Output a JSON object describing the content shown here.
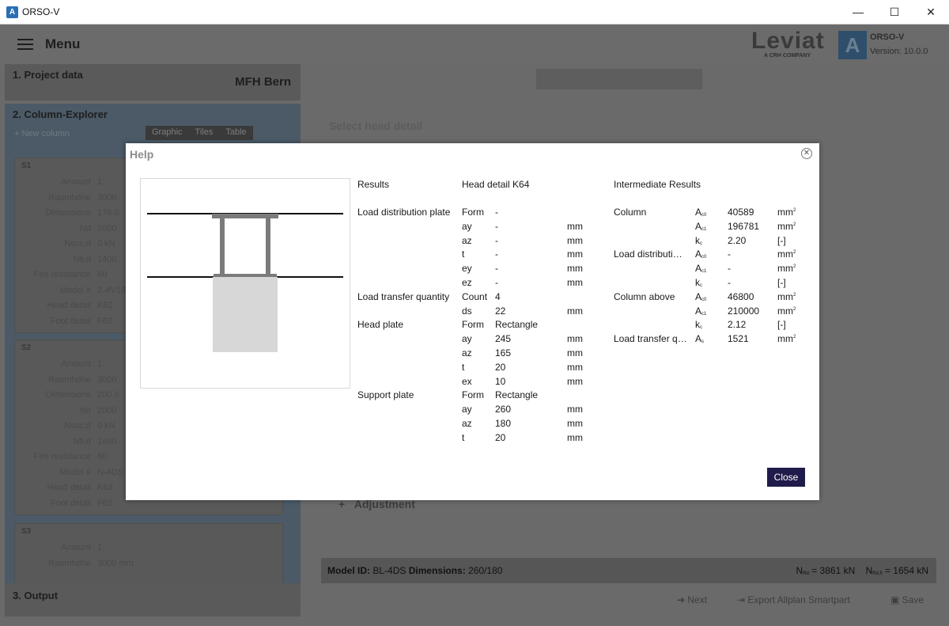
{
  "window": {
    "title": "ORSO-V",
    "app_icon": "A",
    "minimize": "—",
    "maximize": "☐",
    "close": "✕"
  },
  "header": {
    "menu_label": "Menu",
    "brand": "Leviat",
    "brand_sub": "A CRH COMPANY",
    "product": "ORSO-V",
    "version": "Version: 10.0.0",
    "logo_letter": "A"
  },
  "sidebar": {
    "project": {
      "title": "1. Project data",
      "name": "MFH Bern"
    },
    "explorer": {
      "title": "2. Column-Explorer",
      "new_column": "+ New column",
      "tabs": [
        "Graphic",
        "Tiles",
        "Table"
      ],
      "cards": [
        {
          "tag": "S1",
          "rows": [
            [
              "Amount",
              "1"
            ],
            [
              "Raumhöhe",
              "3000"
            ],
            [
              "Dimensions",
              "176.0"
            ],
            [
              "Nd",
              "2000"
            ],
            [
              "Nscc,d",
              "0 kN"
            ],
            [
              "Nfi,d",
              "1400"
            ],
            [
              "Fire resistance",
              "60"
            ],
            [
              "Model #",
              "Z-4V18"
            ],
            [
              "Head detail",
              "K62"
            ],
            [
              "Foot detail",
              "F62"
            ]
          ]
        },
        {
          "tag": "S2",
          "rows": [
            [
              "Amount",
              "1"
            ],
            [
              "Raumhöhe",
              "3000"
            ],
            [
              "Dimensions",
              "200.0"
            ],
            [
              "Nd",
              "2000"
            ],
            [
              "Nscc,d",
              "0 kN"
            ],
            [
              "Nfi,d",
              "1400"
            ],
            [
              "Fire resistance",
              "60"
            ],
            [
              "Model #",
              "N-4DS"
            ],
            [
              "Head detail",
              "K63"
            ],
            [
              "Foot detail",
              "F62"
            ]
          ]
        },
        {
          "tag": "S3",
          "rows": [
            [
              "Amount",
              "1"
            ],
            [
              "Raumhöhe",
              "3000 mm"
            ]
          ]
        }
      ]
    },
    "output": {
      "title": "3. Output"
    }
  },
  "main": {
    "select_head": "Select head detail",
    "adjustment": "Adjustment",
    "status_left_label": "Model ID:",
    "status_left_value": "BL-4DS",
    "status_dim_label": "Dimensions:",
    "status_dim_value": "260/180",
    "status_right_1": "= 3861 kN",
    "status_right_2": "= 1654 kN",
    "next": "Next",
    "export": "Export Allplan Smartpart",
    "save": "Save"
  },
  "dialog": {
    "title": "Help",
    "close_label": "Close",
    "results_header": "Results",
    "head_detail": "Head detail K64",
    "intermediate_header": "Intermediate Results",
    "groups": [
      {
        "name": "Load distribution plate",
        "rows": [
          [
            "Form",
            "-",
            ""
          ],
          [
            "ay",
            "-",
            "mm"
          ],
          [
            "az",
            "-",
            "mm"
          ],
          [
            "t",
            "-",
            "mm"
          ],
          [
            "ey",
            "-",
            "mm"
          ],
          [
            "ez",
            "-",
            "mm"
          ]
        ]
      },
      {
        "name": "Load transfer quantity",
        "rows": [
          [
            "Count",
            "4",
            ""
          ],
          [
            "ds",
            "22",
            "mm"
          ]
        ]
      },
      {
        "name": "Head plate",
        "rows": [
          [
            "Form",
            "Rectangle",
            ""
          ],
          [
            "ay",
            "245",
            "mm"
          ],
          [
            "az",
            "165",
            "mm"
          ],
          [
            "t",
            "20",
            "mm"
          ],
          [
            "ex",
            "10",
            "mm"
          ]
        ]
      },
      {
        "name": "Support plate",
        "rows": [
          [
            "Form",
            "Rectangle",
            ""
          ],
          [
            "ay",
            "260",
            "mm"
          ],
          [
            "az",
            "180",
            "mm"
          ],
          [
            "t",
            "20",
            "mm"
          ]
        ]
      }
    ],
    "intermediate": [
      {
        "name": "Column",
        "rows": [
          [
            "A",
            "c0",
            "40589",
            "mm",
            "2"
          ],
          [
            "A",
            "c1",
            "196781",
            "mm",
            "2"
          ],
          [
            "k",
            "c",
            "2.20",
            "[-]",
            ""
          ]
        ]
      },
      {
        "name": "Load distributi…",
        "rows": [
          [
            "A",
            "c0",
            "-",
            "mm",
            "2"
          ],
          [
            "A",
            "c1",
            "-",
            "mm",
            "2"
          ],
          [
            "k",
            "c",
            "-",
            "[-]",
            ""
          ]
        ]
      },
      {
        "name": "Column above",
        "rows": [
          [
            "A",
            "c0",
            "46800",
            "mm",
            "2"
          ],
          [
            "A",
            "c1",
            "210000",
            "mm",
            "2"
          ],
          [
            "k",
            "c",
            "2.12",
            "[-]",
            ""
          ]
        ]
      },
      {
        "name": "Load transfer q…",
        "rows": [
          [
            "A",
            "s",
            "1521",
            "mm",
            "2"
          ]
        ]
      }
    ]
  }
}
